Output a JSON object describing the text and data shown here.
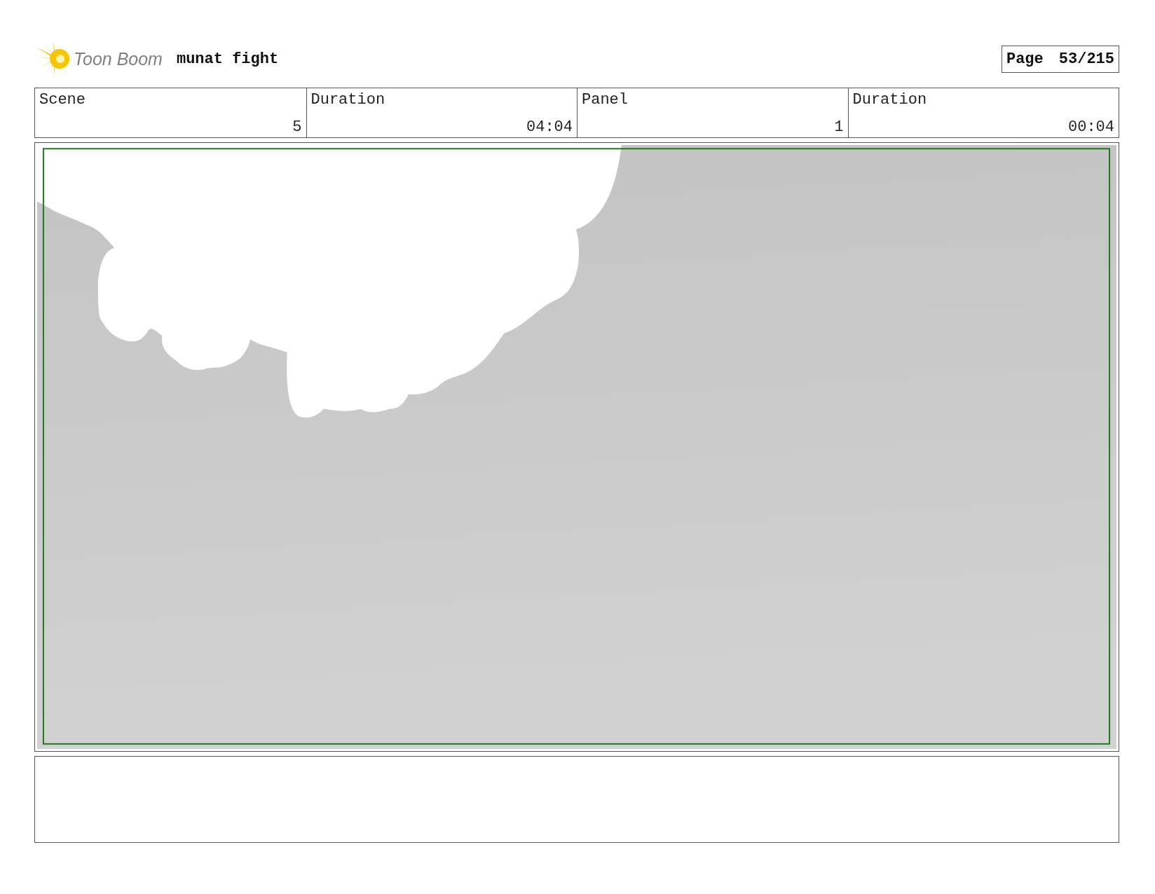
{
  "header": {
    "logo": "Toon Boom",
    "title": "munat fight",
    "page_label": "Page",
    "page_number": "53/215"
  },
  "info_table": {
    "columns": [
      "Scene",
      "Duration",
      "Panel",
      "Duration"
    ],
    "values": [
      "5",
      "04:04",
      "1",
      "00:04"
    ]
  }
}
